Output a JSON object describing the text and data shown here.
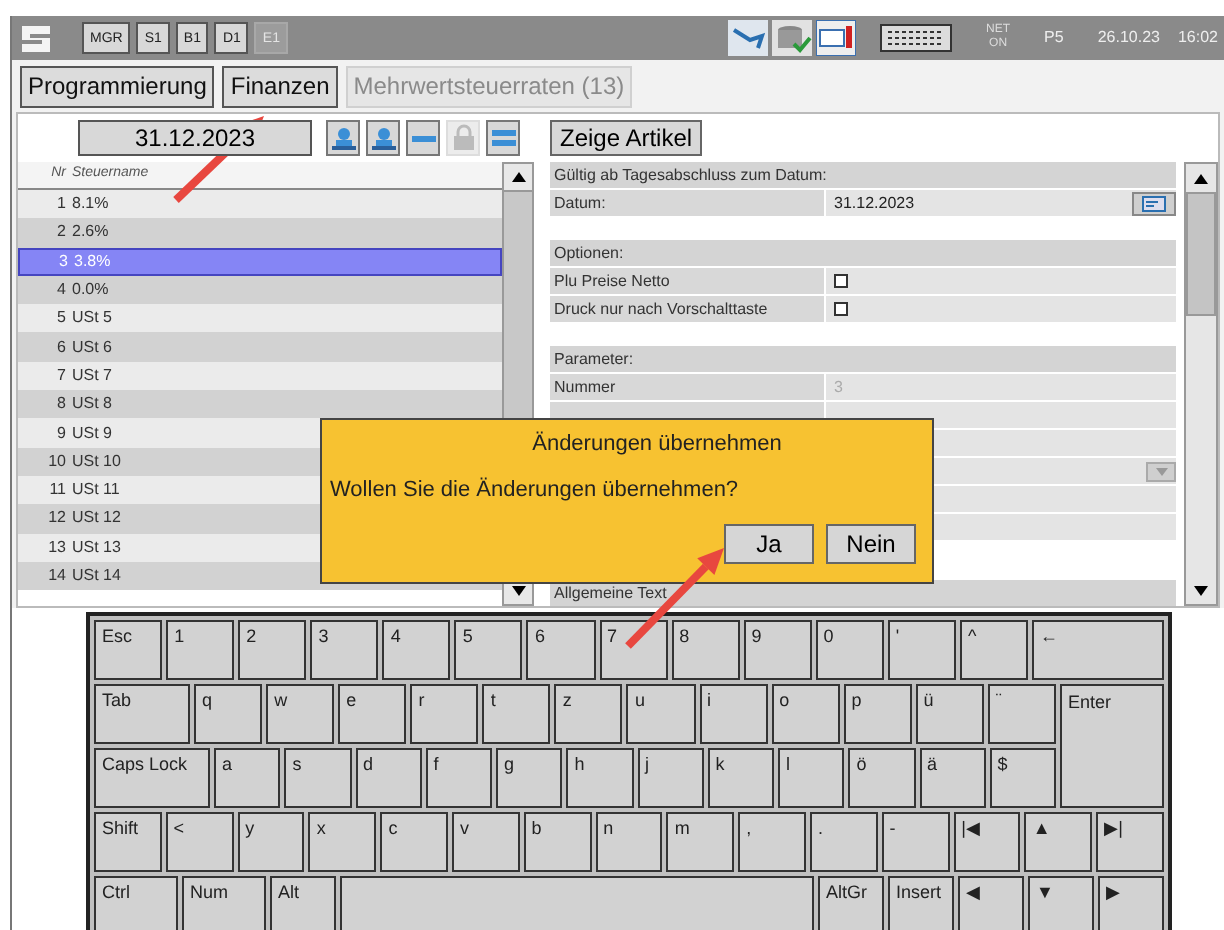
{
  "top_bar": {
    "buttons": [
      {
        "label": "MGR",
        "disabled": false
      },
      {
        "label": "S1",
        "disabled": false
      },
      {
        "label": "B1",
        "disabled": false
      },
      {
        "label": "D1",
        "disabled": false
      },
      {
        "label": "E1",
        "disabled": true
      }
    ],
    "status": {
      "net_top": "NET",
      "net_bottom": "ON",
      "printer": "P5",
      "date": "26.10.23",
      "time": "16:02"
    }
  },
  "tabs": [
    {
      "label": "Programmierung",
      "disabled": false
    },
    {
      "label": "Finanzen",
      "disabled": false
    },
    {
      "label": "Mehrwertsteuerraten (13)",
      "disabled": true
    }
  ],
  "date_field": {
    "value": "31.12.2023"
  },
  "toolbar": [
    {
      "kind": "person",
      "disabled": false
    },
    {
      "kind": "person",
      "disabled": false
    },
    {
      "kind": "minus",
      "disabled": false
    },
    {
      "kind": "lock",
      "disabled": true
    },
    {
      "kind": "equals",
      "disabled": false
    }
  ],
  "show_button": "Zeige Artikel",
  "tax_list": {
    "columns": [
      "Nr",
      "Steuername"
    ],
    "rows": [
      {
        "nr": "1",
        "name": "8.1%",
        "selected": false
      },
      {
        "nr": "2",
        "name": "2.6%",
        "selected": false
      },
      {
        "nr": "3",
        "name": "3.8%",
        "selected": true
      },
      {
        "nr": "4",
        "name": "0.0%",
        "selected": false
      },
      {
        "nr": "5",
        "name": "USt 5",
        "selected": false
      },
      {
        "nr": "6",
        "name": "USt 6",
        "selected": false
      },
      {
        "nr": "7",
        "name": "USt 7",
        "selected": false
      },
      {
        "nr": "8",
        "name": "USt 8",
        "selected": false
      },
      {
        "nr": "9",
        "name": "USt 9",
        "selected": false
      },
      {
        "nr": "10",
        "name": "USt 10",
        "selected": false
      },
      {
        "nr": "11",
        "name": "USt 11",
        "selected": false
      },
      {
        "nr": "12",
        "name": "USt 12",
        "selected": false
      },
      {
        "nr": "13",
        "name": "USt 13",
        "selected": false
      },
      {
        "nr": "14",
        "name": "USt 14",
        "selected": false
      }
    ]
  },
  "details": {
    "sections": [
      {
        "header": "Gültig ab Tagesabschluss zum Datum:",
        "fields": [
          {
            "kind": "date",
            "label": "Datum:",
            "value": "31.12.2023"
          }
        ]
      },
      {
        "header": "Optionen:",
        "fields": [
          {
            "kind": "checkbox",
            "label": "Plu Preise Netto",
            "checked": false
          },
          {
            "kind": "checkbox",
            "label": "Druck nur nach Vorschalttaste",
            "checked": false
          }
        ]
      },
      {
        "header": "Parameter:",
        "fields": [
          {
            "kind": "text",
            "label": "Nummer",
            "value": "3",
            "disabled": true
          },
          {
            "kind": "text"
          },
          {
            "kind": "text"
          },
          {
            "kind": "dropdown"
          },
          {
            "kind": "text"
          },
          {
            "kind": "text"
          }
        ]
      },
      {
        "header": "Allgemeine Text"
      }
    ]
  },
  "dialog": {
    "title": "Änderungen übernehmen",
    "message": "Wollen Sie die Änderungen übernehmen?",
    "buttons": [
      "Ja",
      "Nein"
    ]
  },
  "keyboard": {
    "rows": [
      {
        "keys": [
          {
            "label": "Esc"
          },
          {
            "label": "1"
          },
          {
            "label": "2"
          },
          {
            "label": "3"
          },
          {
            "label": "4"
          },
          {
            "label": "5"
          },
          {
            "label": "6"
          },
          {
            "label": "7"
          },
          {
            "label": "8"
          },
          {
            "label": "9"
          },
          {
            "label": "0"
          },
          {
            "label": "'"
          },
          {
            "label": "^"
          },
          {
            "label": "←",
            "kind": "backspace"
          }
        ]
      },
      {
        "keys": [
          {
            "label": "Tab",
            "kind": "tab"
          },
          {
            "label": "q"
          },
          {
            "label": "w"
          },
          {
            "label": "e"
          },
          {
            "label": "r"
          },
          {
            "label": "t"
          },
          {
            "label": "z"
          },
          {
            "label": "u"
          },
          {
            "label": "i"
          },
          {
            "label": "o"
          },
          {
            "label": "p"
          },
          {
            "label": "ü"
          },
          {
            "label": "¨"
          },
          {
            "label": "Enter",
            "kind": "enter"
          }
        ]
      },
      {
        "keys": [
          {
            "label": "Caps Lock",
            "kind": "caps"
          },
          {
            "label": "a"
          },
          {
            "label": "s"
          },
          {
            "label": "d"
          },
          {
            "label": "f"
          },
          {
            "label": "g"
          },
          {
            "label": "h"
          },
          {
            "label": "j"
          },
          {
            "label": "k"
          },
          {
            "label": "l"
          },
          {
            "label": "ö"
          },
          {
            "label": "ä"
          },
          {
            "label": "$"
          }
        ]
      },
      {
        "keys": [
          {
            "label": "Shift"
          },
          {
            "label": "<"
          },
          {
            "label": "y"
          },
          {
            "label": "x"
          },
          {
            "label": "c"
          },
          {
            "label": "v"
          },
          {
            "label": "b"
          },
          {
            "label": "n"
          },
          {
            "label": "m"
          },
          {
            "label": ","
          },
          {
            "label": "."
          },
          {
            "label": "-"
          },
          {
            "label": "|◀"
          },
          {
            "label": "▲"
          },
          {
            "label": "▶|"
          }
        ]
      },
      {
        "keys": [
          {
            "label": "Ctrl",
            "kind": "mod"
          },
          {
            "label": "Num",
            "kind": "mod"
          },
          {
            "label": "Alt"
          },
          {
            "kind": "space"
          },
          {
            "label": "AltGr"
          },
          {
            "label": "Insert"
          },
          {
            "label": "◀"
          },
          {
            "label": "▼"
          },
          {
            "label": "▶"
          }
        ]
      }
    ]
  },
  "annotations": [
    {
      "kind": "arrow"
    },
    {
      "kind": "arrow"
    }
  ]
}
